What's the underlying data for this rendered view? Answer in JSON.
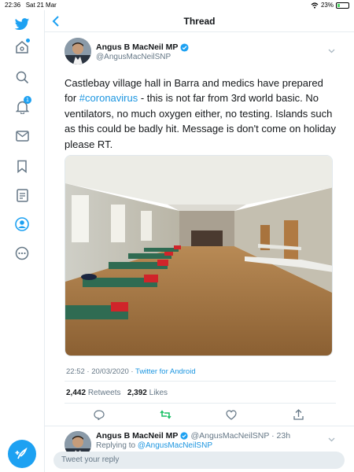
{
  "status_bar": {
    "time": "22:36",
    "date": "Sat 21 Mar",
    "battery": "23%",
    "battery_level": 0.23
  },
  "sidebar": {
    "items": [
      {
        "icon": "twitter-bird-icon"
      },
      {
        "icon": "home-icon",
        "has_dot": true
      },
      {
        "icon": "search-icon"
      },
      {
        "icon": "bell-icon",
        "badge": "1"
      },
      {
        "icon": "mail-icon"
      },
      {
        "icon": "bookmark-icon"
      },
      {
        "icon": "lists-icon"
      },
      {
        "icon": "profile-icon"
      },
      {
        "icon": "more-icon"
      }
    ],
    "compose_icon": "compose-tweet-icon"
  },
  "header": {
    "title": "Thread"
  },
  "tweet": {
    "author_name": "Angus B MacNeil MP",
    "handle": "@AngusMacNeilSNP",
    "text_before": "Castlebay village hall in Barra and medics have prepared for ",
    "hashtag": "#coronavirus",
    "text_after": " - this is not far from 3rd world basic.  No ventilators, no much oxygen either, no testing.  Islands such as this could be badly hit. Message is don't come on holiday please RT.",
    "timestamp": "22:52 · 20/03/2020 · ",
    "source": "Twitter for Android",
    "retweets": "2,442",
    "retweets_label": "Retweets",
    "likes": "2,392",
    "likes_label": "Likes"
  },
  "reply": {
    "author_name": "Angus B MacNeil MP",
    "handle_time": "@AngusMacNeilSNP · 23h",
    "replying_prefix": "Replying to ",
    "replying_handle": "@AngusMacNeilSNP"
  },
  "composer": {
    "placeholder": "Tweet your reply"
  },
  "colors": {
    "accent": "#1da1f2",
    "retweet_green": "#17bf63",
    "verified": "#1da1f2"
  }
}
